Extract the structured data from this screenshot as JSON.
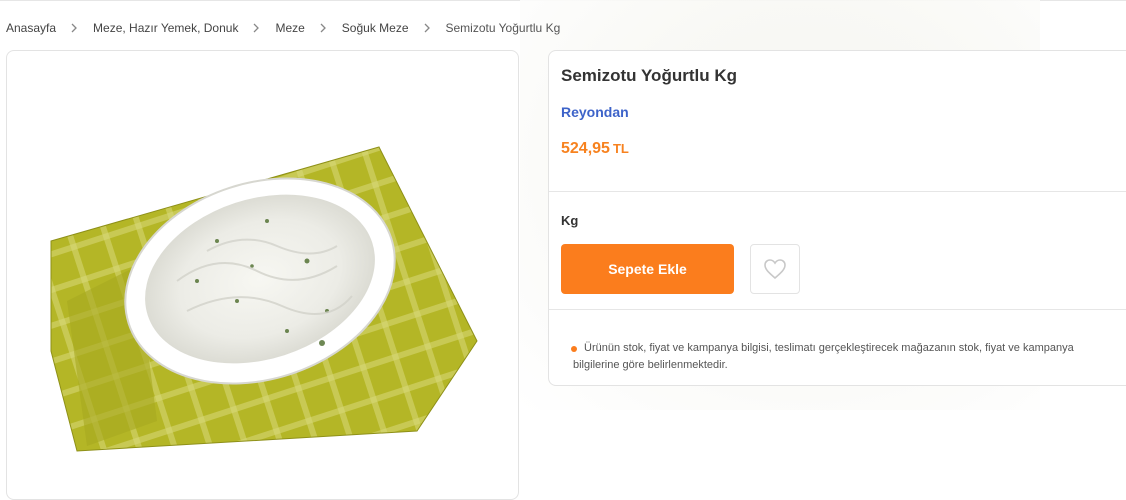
{
  "breadcrumb": {
    "items": [
      {
        "label": "Anasayfa"
      },
      {
        "label": "Meze, Hazır Yemek, Donuk"
      },
      {
        "label": "Meze"
      },
      {
        "label": "Soğuk Meze"
      },
      {
        "label": "Semizotu Yoğurtlu Kg"
      }
    ]
  },
  "product": {
    "title": "Semizotu Yoğurtlu Kg",
    "seller": "Reyondan",
    "price": "524,95",
    "currency": "TL",
    "unit": "Kg",
    "add_to_cart": "Sepete Ekle",
    "favorite_icon": "heart-icon",
    "image_icon": "product-image",
    "notice": "Ürünün stok, fiyat ve kampanya bilgisi, teslimatı gerçekleştirecek mağazanın stok, fiyat ve kampanya bilgilerine göre belirlenmektedir."
  },
  "colors": {
    "accent": "#fb7d1d",
    "price": "#f7821f",
    "seller_link": "#3d63c9",
    "border": "#e3e3e3"
  }
}
